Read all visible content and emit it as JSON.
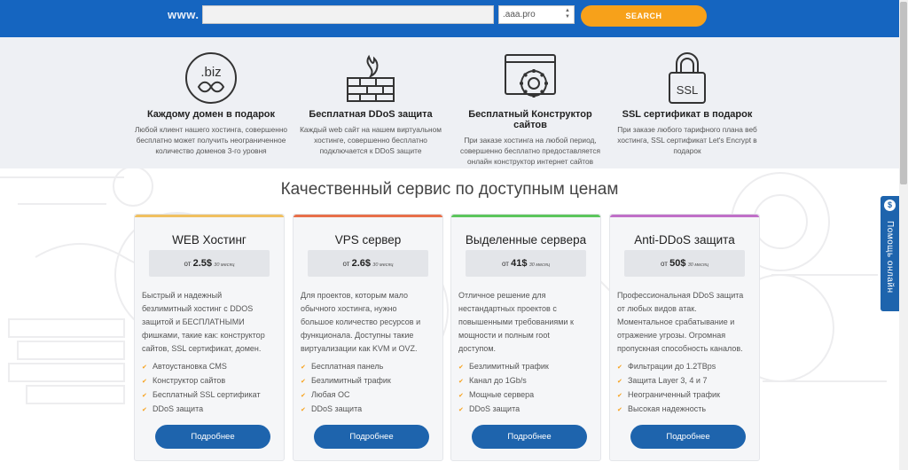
{
  "search": {
    "prefix": "www.",
    "domain_value": "",
    "zone_selected": ".aaa.pro",
    "button_label": "SEARCH"
  },
  "features": [
    {
      "icon": "biz-domain-icon",
      "icon_text": ".biz",
      "title": "Каждому домен в подарок",
      "desc_lines": [
        "Любой клиент нашего хостинга, совершенно",
        "бесплатно может получить неограниченное",
        "количество доменов 3-го уровня"
      ]
    },
    {
      "icon": "firewall-icon",
      "title": "Бесплатная DDoS защита",
      "desc_lines": [
        "Каждый web сайт на нашем виртуальном",
        "хостинге, совершенно бесплатно",
        "подключается к DDoS защите"
      ]
    },
    {
      "icon": "site-builder-icon",
      "title": "Бесплатный Конструктор сайтов",
      "desc_lines": [
        "При заказе хостинга на любой период,",
        "совершенно бесплатно предоставляется",
        "онлайн конструктор интернет сайтов"
      ]
    },
    {
      "icon": "ssl-lock-icon",
      "icon_text": "SSL",
      "title": "SSL сертификат в подарок",
      "desc_lines": [
        "При заказе любого тарифного плана веб",
        "хостинга, SSL сертификат Let's Encrypt в",
        "подарок"
      ]
    }
  ],
  "section_title": "Качественный сервис по доступным ценам",
  "plans": [
    {
      "title": "WEB Хостинг",
      "accent": "#f0c060",
      "price_prefix": "от",
      "price": "2.5$",
      "period": "30 месяц",
      "desc_lines": [
        "Быстрый и надежный",
        "безлимитный хостинг с DDOS",
        "защитой и БЕСПЛАТНЫМИ",
        "фишками, такие как: конструктор",
        "сайтов, SSL сертификат, домен."
      ],
      "features": [
        "Автоустановка CMS",
        "Конструктор сайтов",
        "Бесплатный SSL сертификат",
        "DDoS защита"
      ],
      "button": "Подробнее"
    },
    {
      "title": "VPS сервер",
      "accent": "#e8704a",
      "price_prefix": "от",
      "price": "2.6$",
      "period": "30 месяц",
      "desc_lines": [
        "Для проектов, которым мало",
        "обычного хостинга, нужно",
        "большое количество ресурсов и",
        "функционала. Доступны такие",
        "виртуализации как KVM и OVZ."
      ],
      "features": [
        "Бесплатная панель",
        "Безлимитный трафик",
        "Любая ОС",
        "DDoS защита"
      ],
      "button": "Подробнее"
    },
    {
      "title": "Выделенные сервера",
      "accent": "#5cc65c",
      "price_prefix": "от",
      "price": "41$",
      "period": "30 месяц",
      "desc_lines": [
        "Отличное решение для",
        "нестандартных проектов с",
        "повышенными требованиями к",
        "мощности и полным root",
        "доступом."
      ],
      "features": [
        "Безлимитный трафик",
        "Канал до 1Gb/s",
        "Мощные сервера",
        "DDoS защита"
      ],
      "button": "Подробнее"
    },
    {
      "title": "Anti-DDoS защита",
      "accent": "#c070c8",
      "price_prefix": "от",
      "price": "50$",
      "period": "30 месяц",
      "desc_lines": [
        "Профессиональная DDoS защита",
        "от любых видов атак.",
        "Моментальное срабатывание и",
        "отражение угрозы. Огромная",
        "пропускная способность каналов."
      ],
      "features": [
        "Фильтрации до 1.2TBps",
        "Защита Layer 3, 4 и 7",
        "Неограниченный трафик",
        "Высокая надежность"
      ],
      "button": "Подробнее"
    }
  ],
  "help_widget": {
    "label": "Помощь онлайн"
  },
  "colors": {
    "header": "#1565c0",
    "search_button": "#f7a11a",
    "card_button": "#1e64ad",
    "band": "#eef0f4"
  }
}
